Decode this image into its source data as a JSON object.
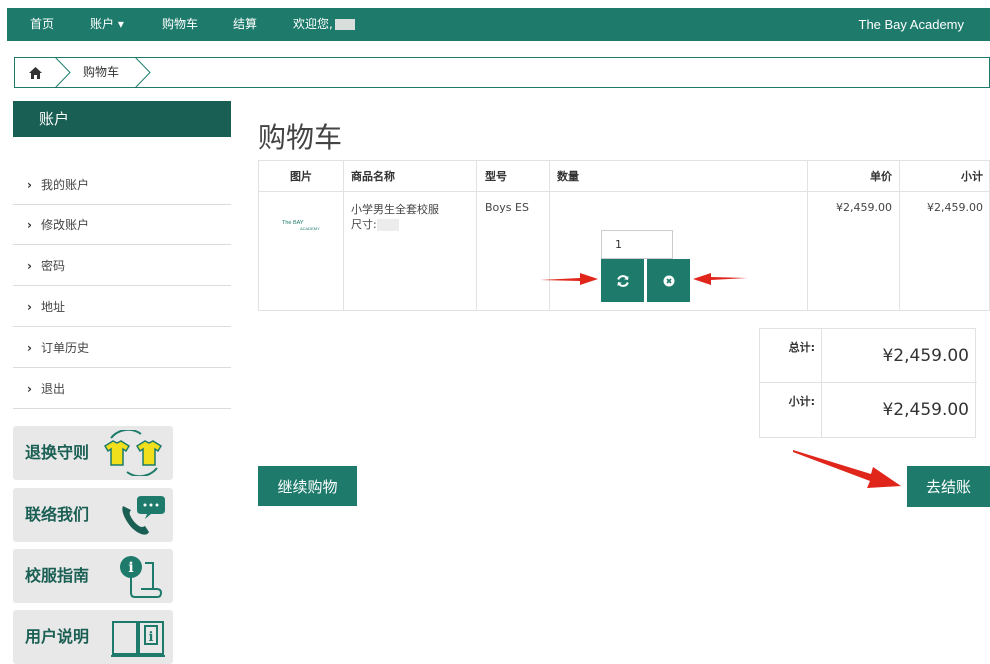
{
  "nav": {
    "home": "首页",
    "account": "账户",
    "account_caret": "▾",
    "cart": "购物车",
    "checkout": "结算",
    "welcome": "欢迎您,",
    "brand": "The Bay Academy"
  },
  "breadcrumb": {
    "current": "购物车"
  },
  "sidebar": {
    "title": "账户",
    "items": [
      {
        "label": "我的账户"
      },
      {
        "label": "修改账户"
      },
      {
        "label": "密码"
      },
      {
        "label": "地址"
      },
      {
        "label": "订单历史"
      },
      {
        "label": "退出"
      }
    ],
    "promos": [
      {
        "label": "退换守则",
        "icon": "tshirt-exchange-icon"
      },
      {
        "label": "联络我们",
        "icon": "phone-chat-icon"
      },
      {
        "label": "校服指南",
        "icon": "info-scroll-icon"
      },
      {
        "label": "用户说明",
        "icon": "info-book-icon"
      }
    ]
  },
  "page": {
    "title": "购物车"
  },
  "cart": {
    "headers": {
      "image": "图片",
      "name": "商品名称",
      "model": "型号",
      "quantity": "数量",
      "unit_price": "单价",
      "subtotal": "小计"
    },
    "rows": [
      {
        "name": "小学男生全套校服",
        "size_label": "尺寸:",
        "model": "Boys ES",
        "quantity": "1",
        "unit_price": "¥2,459.00",
        "subtotal": "¥2,459.00",
        "logo_text": "The BAY",
        "logo_sub": "ACADEMY"
      }
    ]
  },
  "totals": {
    "total_label": "总计:",
    "total_value": "¥2,459.00",
    "subtotal_label": "小计:",
    "subtotal_value": "¥2,459.00"
  },
  "buttons": {
    "continue": "继续购物",
    "checkout": "去结账"
  },
  "colors": {
    "primary": "#1e7b6b",
    "dark_green": "#1a5f53",
    "arrow_red": "#e0251b",
    "promo_bg": "#e8e8e8"
  }
}
